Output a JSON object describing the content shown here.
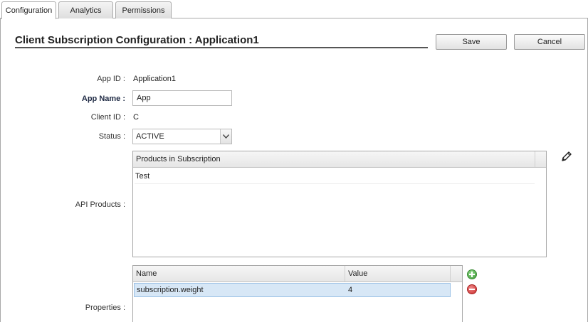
{
  "tabs": [
    {
      "label": "Configuration",
      "active": true
    },
    {
      "label": "Analytics",
      "active": false
    },
    {
      "label": "Permissions",
      "active": false
    }
  ],
  "header": {
    "title": "Client Subscription Configuration : Application1",
    "save_label": "Save",
    "cancel_label": "Cancel"
  },
  "form": {
    "app_id_label": "App ID :",
    "app_id_value": "Application1",
    "app_name_label": "App Name :",
    "app_name_value": "App",
    "client_id_label": "Client ID :",
    "client_id_value": "C",
    "status_label": "Status :",
    "status_value": "ACTIVE",
    "api_products_label": "API Products :",
    "properties_label": "Properties :"
  },
  "products_grid": {
    "header": "Products in Subscription",
    "rows": [
      "Test"
    ]
  },
  "properties_grid": {
    "columns": [
      "Name",
      "Value"
    ],
    "rows": [
      {
        "name": "subscription.weight",
        "value": "4"
      }
    ]
  },
  "icons": {
    "edit": "pencil-icon",
    "add": "add-icon",
    "remove": "remove-icon",
    "dropdown": "chevron-down-icon"
  },
  "colors": {
    "selected_row": "#d7e7f6",
    "add_green": "#3e9a36",
    "remove_red": "#c92b2b"
  }
}
